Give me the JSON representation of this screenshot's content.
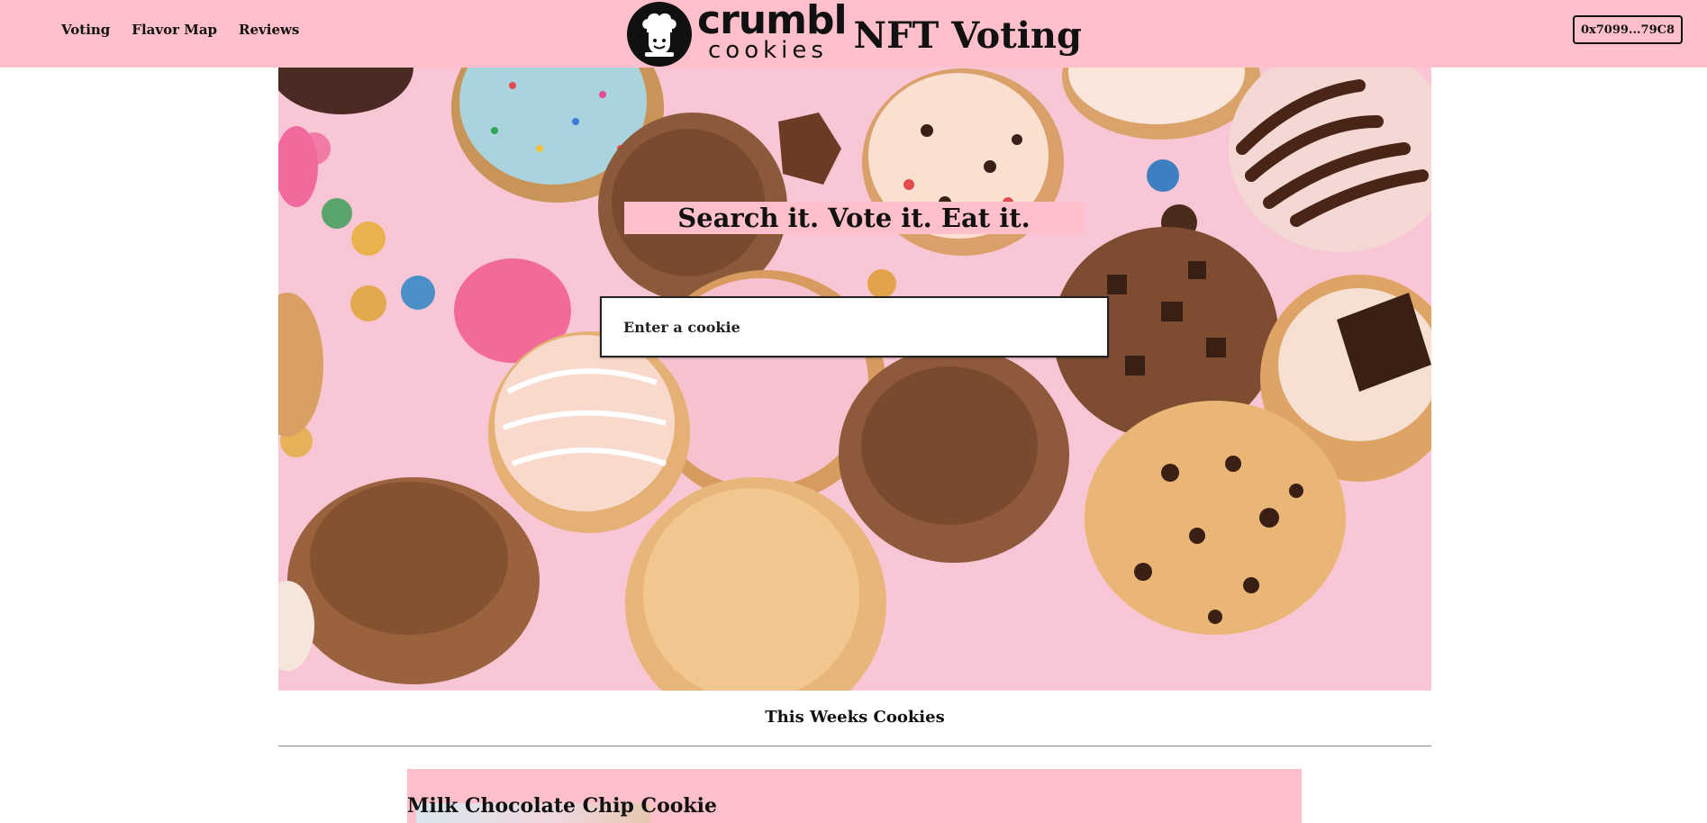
{
  "nav": {
    "items": [
      {
        "label": "Voting"
      },
      {
        "label": "Flavor Map"
      },
      {
        "label": "Reviews"
      }
    ]
  },
  "brand": {
    "logo_word": "crumbl",
    "logo_sub": "cookies",
    "title": "NFT Voting"
  },
  "wallet": {
    "address": "0x7099...79C8"
  },
  "hero": {
    "tagline": "Search it. Vote it. Eat it.",
    "search_placeholder": "Enter a cookie"
  },
  "weekly": {
    "section_title": "This Weeks Cookies",
    "cards": [
      {
        "title": "Milk Chocolate Chip Cookie"
      }
    ]
  },
  "colors": {
    "header_bg": "#ffc0cb",
    "accent_pink": "#ffc0cb",
    "text": "#111111"
  },
  "icons": {
    "logo": "chef-logo-icon"
  }
}
